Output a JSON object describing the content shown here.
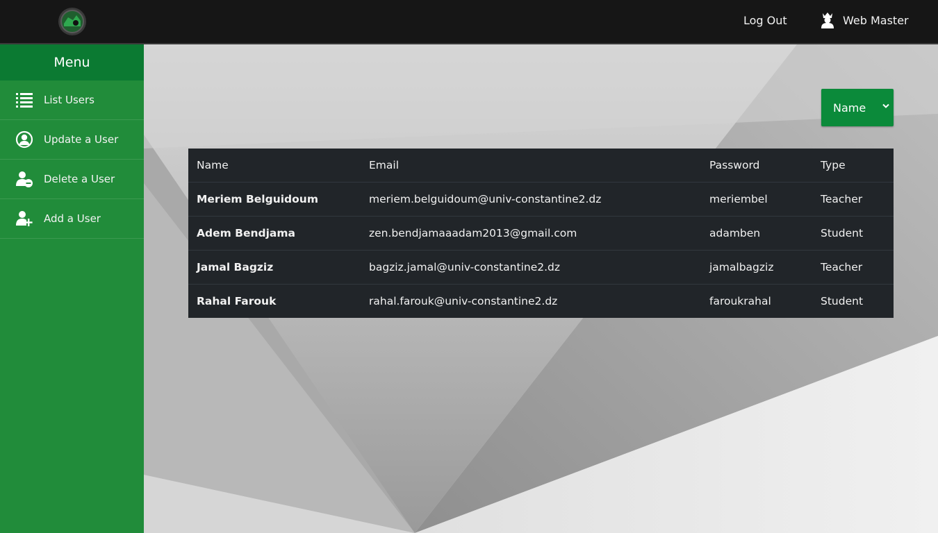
{
  "header": {
    "logout_label": "Log Out",
    "user_name": "Web Master"
  },
  "sidebar": {
    "title": "Menu",
    "items": [
      {
        "label": "List Users",
        "icon": "list-icon"
      },
      {
        "label": "Update a User",
        "icon": "user-circle-icon"
      },
      {
        "label": "Delete a User",
        "icon": "user-minus-icon"
      },
      {
        "label": "Add a User",
        "icon": "user-plus-icon"
      }
    ]
  },
  "sort": {
    "selected": "Name"
  },
  "table": {
    "headers": [
      "Name",
      "Email",
      "Password",
      "Type"
    ],
    "rows": [
      {
        "name": "Meriem Belguidoum",
        "email": "meriem.belguidoum@univ-constantine2.dz",
        "password": "meriembel",
        "type": "Teacher"
      },
      {
        "name": "Adem Bendjama",
        "email": "zen.bendjamaaadam2013@gmail.com",
        "password": "adamben",
        "type": "Student"
      },
      {
        "name": "Jamal Bagziz",
        "email": "bagziz.jamal@univ-constantine2.dz",
        "password": "jamalbagziz",
        "type": "Teacher"
      },
      {
        "name": "Rahal Farouk",
        "email": "rahal.farouk@univ-constantine2.dz",
        "password": "faroukrahal",
        "type": "Student"
      }
    ]
  },
  "colors": {
    "topbar": "#161616",
    "sidebar": "#218c3a",
    "sidebar_header": "#0b7a32",
    "accent": "#0b8a3a",
    "table_bg": "#212529"
  }
}
